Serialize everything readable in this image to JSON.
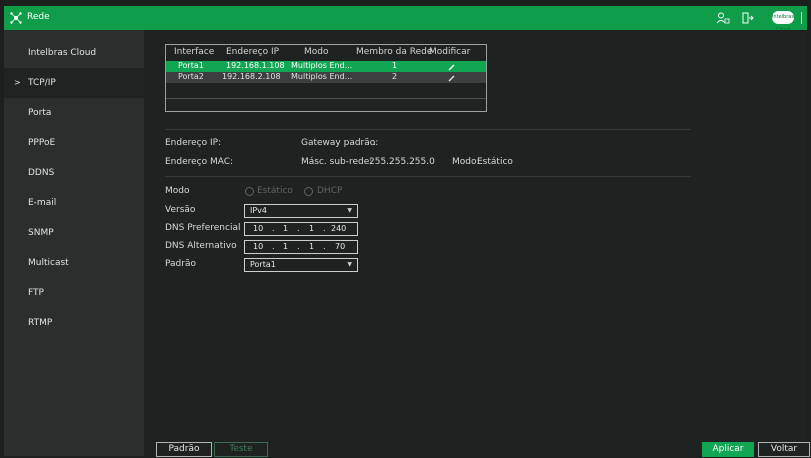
{
  "window": {
    "title": "Rede"
  },
  "sidebar": {
    "items": [
      {
        "label": "Intelbras Cloud"
      },
      {
        "label": "TCP/IP"
      },
      {
        "label": "Porta"
      },
      {
        "label": "PPPoE"
      },
      {
        "label": "DDNS"
      },
      {
        "label": "E-mail"
      },
      {
        "label": "SNMP"
      },
      {
        "label": "Multicast"
      },
      {
        "label": "FTP"
      },
      {
        "label": "RTMP"
      }
    ],
    "active_index": 1,
    "active_marker": ">"
  },
  "interfaces": {
    "headers": [
      "Interface",
      "Endereço IP",
      "Modo",
      "Membro da Rede",
      "Modificar"
    ],
    "rows": [
      {
        "interface": "Porta1",
        "ip": "192.168.1.108",
        "mode": "Multiplos End...",
        "member": "1"
      },
      {
        "interface": "Porta2",
        "ip": "192.168.2.108",
        "mode": "Multiplos End...",
        "member": "2"
      }
    ]
  },
  "info": {
    "ip_label": "Endereço IP:",
    "gateway_label": "Gateway padrão:",
    "gateway_value": ".",
    "mac_label": "Endereço MAC:",
    "mask_label": "Másc. sub-rede:",
    "mask_value": "255.255.255.0",
    "mode_label": "Modo:",
    "mode_value": "Estático"
  },
  "form": {
    "mode_label": "Modo",
    "mode_options": [
      "Estático",
      "DHCP"
    ],
    "version_label": "Versão",
    "version_value": "IPv4",
    "dns_pref_label": "DNS Preferencial",
    "dns_pref": [
      "10",
      "1",
      "1",
      "240"
    ],
    "dns_alt_label": "DNS Alternativo",
    "dns_alt": [
      "10",
      "1",
      "1",
      "70"
    ],
    "default_label": "Padrão",
    "default_value": "Porta1",
    "ip_dot": "."
  },
  "buttons": {
    "default": "Padrão",
    "test": "Teste",
    "apply": "Aplicar",
    "back": "Voltar"
  },
  "toolbar": {
    "cloud_text": "intelbras Cloud"
  },
  "colors": {
    "accent": "#10a653",
    "titlebar": "#0f9d4a",
    "sidebar": "#2a2f2e",
    "background": "#1e2322"
  }
}
